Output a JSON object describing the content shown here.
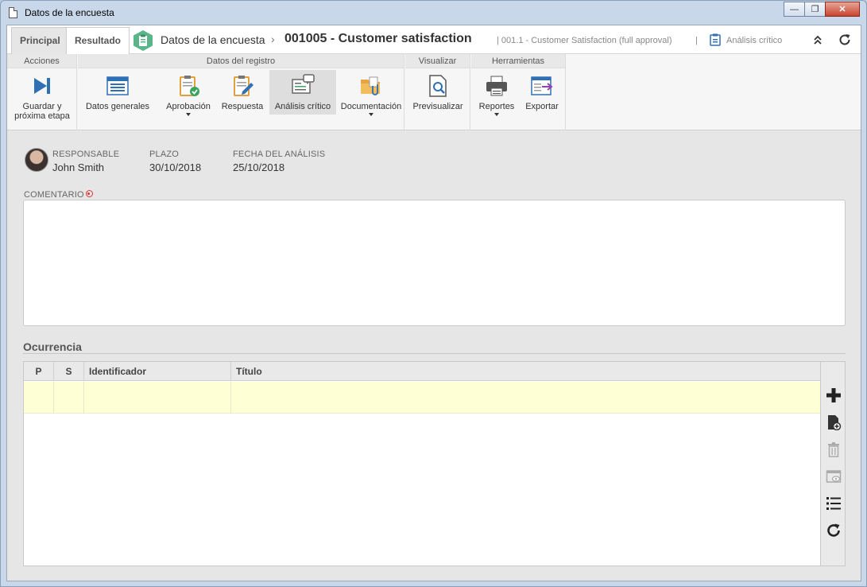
{
  "window": {
    "title": "Datos de la encuesta",
    "minimize": "—",
    "maximize": "❐",
    "close": "✕"
  },
  "header": {
    "tabs": [
      {
        "label": "Principal",
        "active": true
      },
      {
        "label": "Resultado",
        "active": false
      }
    ],
    "breadcrumb": "Datos de la encuesta",
    "separator": "›",
    "record_title": "001005 - Customer satisfaction",
    "subtitle": "|   001.1 - Customer Satisfaction (full approval)",
    "section_sep": "|",
    "section": "Análisis crítico"
  },
  "ribbon": {
    "groups": {
      "acciones": "Acciones",
      "datos_registro": "Datos del registro",
      "visualizar": "Visualizar",
      "herramientas": "Herramientas"
    },
    "buttons": {
      "guardar_line1": "Guardar y",
      "guardar_line2": "próxima etapa",
      "datos_generales": "Datos generales",
      "aprobacion": "Aprobación",
      "respuesta": "Respuesta",
      "analisis_critico": "Análisis crítico",
      "documentacion": "Documentación",
      "previsualizar": "Previsualizar",
      "reportes": "Reportes",
      "exportar": "Exportar"
    }
  },
  "fields": {
    "responsable_label": "RESPONSABLE",
    "responsable_value": "John Smith",
    "plazo_label": "PLAZO",
    "plazo_value": "30/10/2018",
    "fecha_label": "FECHA DEL ANÁLISIS",
    "fecha_value": "25/10/2018",
    "comentario_label": "COMENTARIO",
    "comentario_value": ""
  },
  "ocurrencia": {
    "title": "Ocurrencia",
    "columns": [
      "P",
      "S",
      "Identificador",
      "Título"
    ]
  },
  "colors": {
    "accent_green": "#5bb58a",
    "selected_row": "#ffffd5",
    "ribbon_blue": "#2f6fb3"
  }
}
